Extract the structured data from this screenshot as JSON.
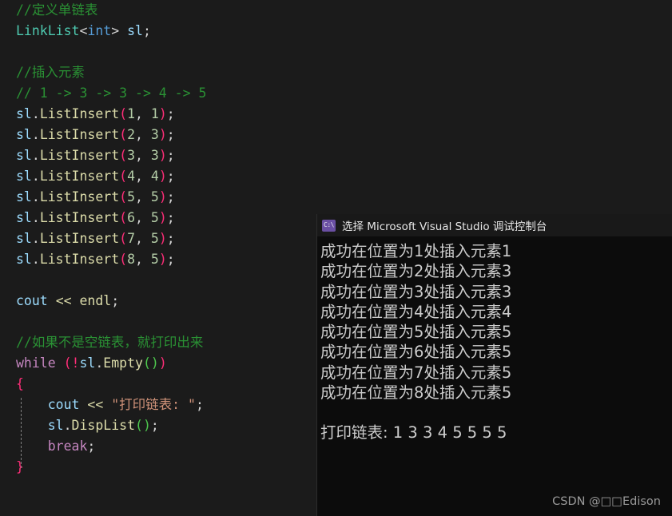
{
  "editor": {
    "background": "#1b1b1b",
    "lines": [
      {
        "tokens": [
          {
            "t": "//定义单链表",
            "c": "c-comment"
          }
        ]
      },
      {
        "tokens": [
          {
            "t": "LinkList",
            "c": "c-type"
          },
          {
            "t": "<",
            "c": "c-punct"
          },
          {
            "t": "int",
            "c": "c-kw"
          },
          {
            "t": ">",
            "c": "c-punct"
          },
          {
            "t": " ",
            "c": "c-punct"
          },
          {
            "t": "sl",
            "c": "c-var"
          },
          {
            "t": ";",
            "c": "c-punct"
          }
        ]
      },
      {
        "tokens": []
      },
      {
        "tokens": [
          {
            "t": "//插入元素",
            "c": "c-comment"
          }
        ]
      },
      {
        "tokens": [
          {
            "t": "// 1 -> 3 -> 3 -> 4 -> 5",
            "c": "c-comment"
          }
        ]
      },
      {
        "tokens": [
          {
            "t": "sl",
            "c": "c-var"
          },
          {
            "t": ".",
            "c": "c-punct"
          },
          {
            "t": "ListInsert",
            "c": "c-fn"
          },
          {
            "t": "(",
            "c": "c-paren"
          },
          {
            "t": "1",
            "c": "c-num"
          },
          {
            "t": ", ",
            "c": "c-punct"
          },
          {
            "t": "1",
            "c": "c-num"
          },
          {
            "t": ")",
            "c": "c-paren"
          },
          {
            "t": ";",
            "c": "c-punct"
          }
        ]
      },
      {
        "tokens": [
          {
            "t": "sl",
            "c": "c-var"
          },
          {
            "t": ".",
            "c": "c-punct"
          },
          {
            "t": "ListInsert",
            "c": "c-fn"
          },
          {
            "t": "(",
            "c": "c-paren"
          },
          {
            "t": "2",
            "c": "c-num"
          },
          {
            "t": ", ",
            "c": "c-punct"
          },
          {
            "t": "3",
            "c": "c-num"
          },
          {
            "t": ")",
            "c": "c-paren"
          },
          {
            "t": ";",
            "c": "c-punct"
          }
        ]
      },
      {
        "tokens": [
          {
            "t": "sl",
            "c": "c-var"
          },
          {
            "t": ".",
            "c": "c-punct"
          },
          {
            "t": "ListInsert",
            "c": "c-fn"
          },
          {
            "t": "(",
            "c": "c-paren"
          },
          {
            "t": "3",
            "c": "c-num"
          },
          {
            "t": ", ",
            "c": "c-punct"
          },
          {
            "t": "3",
            "c": "c-num"
          },
          {
            "t": ")",
            "c": "c-paren"
          },
          {
            "t": ";",
            "c": "c-punct"
          }
        ]
      },
      {
        "tokens": [
          {
            "t": "sl",
            "c": "c-var"
          },
          {
            "t": ".",
            "c": "c-punct"
          },
          {
            "t": "ListInsert",
            "c": "c-fn"
          },
          {
            "t": "(",
            "c": "c-paren"
          },
          {
            "t": "4",
            "c": "c-num"
          },
          {
            "t": ", ",
            "c": "c-punct"
          },
          {
            "t": "4",
            "c": "c-num"
          },
          {
            "t": ")",
            "c": "c-paren"
          },
          {
            "t": ";",
            "c": "c-punct"
          }
        ]
      },
      {
        "tokens": [
          {
            "t": "sl",
            "c": "c-var"
          },
          {
            "t": ".",
            "c": "c-punct"
          },
          {
            "t": "ListInsert",
            "c": "c-fn"
          },
          {
            "t": "(",
            "c": "c-paren"
          },
          {
            "t": "5",
            "c": "c-num"
          },
          {
            "t": ", ",
            "c": "c-punct"
          },
          {
            "t": "5",
            "c": "c-num"
          },
          {
            "t": ")",
            "c": "c-paren"
          },
          {
            "t": ";",
            "c": "c-punct"
          }
        ]
      },
      {
        "tokens": [
          {
            "t": "sl",
            "c": "c-var"
          },
          {
            "t": ".",
            "c": "c-punct"
          },
          {
            "t": "ListInsert",
            "c": "c-fn"
          },
          {
            "t": "(",
            "c": "c-paren"
          },
          {
            "t": "6",
            "c": "c-num"
          },
          {
            "t": ", ",
            "c": "c-punct"
          },
          {
            "t": "5",
            "c": "c-num"
          },
          {
            "t": ")",
            "c": "c-paren"
          },
          {
            "t": ";",
            "c": "c-punct"
          }
        ]
      },
      {
        "tokens": [
          {
            "t": "sl",
            "c": "c-var"
          },
          {
            "t": ".",
            "c": "c-punct"
          },
          {
            "t": "ListInsert",
            "c": "c-fn"
          },
          {
            "t": "(",
            "c": "c-paren"
          },
          {
            "t": "7",
            "c": "c-num"
          },
          {
            "t": ", ",
            "c": "c-punct"
          },
          {
            "t": "5",
            "c": "c-num"
          },
          {
            "t": ")",
            "c": "c-paren"
          },
          {
            "t": ";",
            "c": "c-punct"
          }
        ]
      },
      {
        "tokens": [
          {
            "t": "sl",
            "c": "c-var"
          },
          {
            "t": ".",
            "c": "c-punct"
          },
          {
            "t": "ListInsert",
            "c": "c-fn"
          },
          {
            "t": "(",
            "c": "c-paren"
          },
          {
            "t": "8",
            "c": "c-num"
          },
          {
            "t": ", ",
            "c": "c-punct"
          },
          {
            "t": "5",
            "c": "c-num"
          },
          {
            "t": ")",
            "c": "c-paren"
          },
          {
            "t": ";",
            "c": "c-punct"
          }
        ]
      },
      {
        "tokens": []
      },
      {
        "tokens": [
          {
            "t": "cout",
            "c": "c-var"
          },
          {
            "t": " ",
            "c": "c-punct"
          },
          {
            "t": "<<",
            "c": "c-fn"
          },
          {
            "t": " ",
            "c": "c-punct"
          },
          {
            "t": "endl",
            "c": "c-fn"
          },
          {
            "t": ";",
            "c": "c-punct"
          }
        ]
      },
      {
        "tokens": []
      },
      {
        "tokens": [
          {
            "t": "//如果不是空链表，就打印出来",
            "c": "c-comment"
          }
        ]
      },
      {
        "tokens": [
          {
            "t": "while",
            "c": "c-kwctl"
          },
          {
            "t": " ",
            "c": "c-punct"
          },
          {
            "t": "(",
            "c": "c-paren"
          },
          {
            "t": "!",
            "c": "c-paren"
          },
          {
            "t": "sl",
            "c": "c-var"
          },
          {
            "t": ".",
            "c": "c-punct"
          },
          {
            "t": "Empty",
            "c": "c-fn"
          },
          {
            "t": "(",
            "c": "c-paren2"
          },
          {
            "t": ")",
            "c": "c-paren2"
          },
          {
            "t": ")",
            "c": "c-paren"
          }
        ]
      },
      {
        "tokens": [
          {
            "t": "{",
            "c": "c-paren"
          }
        ]
      },
      {
        "indent": true,
        "tokens": [
          {
            "t": "    cout",
            "c": "c-var"
          },
          {
            "t": " ",
            "c": "c-punct"
          },
          {
            "t": "<<",
            "c": "c-fn"
          },
          {
            "t": " ",
            "c": "c-punct"
          },
          {
            "t": "\"打印链表: \"",
            "c": "c-str"
          },
          {
            "t": ";",
            "c": "c-punct"
          }
        ]
      },
      {
        "indent": true,
        "tokens": [
          {
            "t": "    sl",
            "c": "c-var"
          },
          {
            "t": ".",
            "c": "c-punct"
          },
          {
            "t": "DispList",
            "c": "c-fn"
          },
          {
            "t": "(",
            "c": "c-paren2"
          },
          {
            "t": ")",
            "c": "c-paren2"
          },
          {
            "t": ";",
            "c": "c-punct"
          }
        ]
      },
      {
        "indent": true,
        "tokens": [
          {
            "t": "    break",
            "c": "c-kwctl"
          },
          {
            "t": ";",
            "c": "c-punct"
          }
        ]
      },
      {
        "tokens": [
          {
            "t": "}",
            "c": "c-paren"
          }
        ]
      }
    ]
  },
  "console": {
    "title": "选择 Microsoft Visual Studio 调试控制台",
    "icon_label": "C:\\",
    "icon_name": "console-app-icon",
    "background": "#0c0c0c",
    "titlebar_background": "#191919",
    "text_color": "#cccccc",
    "lines": [
      "成功在位置为1处插入元素1",
      "成功在位置为2处插入元素3",
      "成功在位置为3处插入元素3",
      "成功在位置为4处插入元素4",
      "成功在位置为5处插入元素5",
      "成功在位置为6处插入元素5",
      "成功在位置为7处插入元素5",
      "成功在位置为8处插入元素5",
      "",
      "打印链表: 1 3 3 4 5 5 5 5"
    ]
  },
  "watermark": {
    "text": "CSDN @\u0001\u0002Edison",
    "display": "CSDN @□□Edison"
  }
}
